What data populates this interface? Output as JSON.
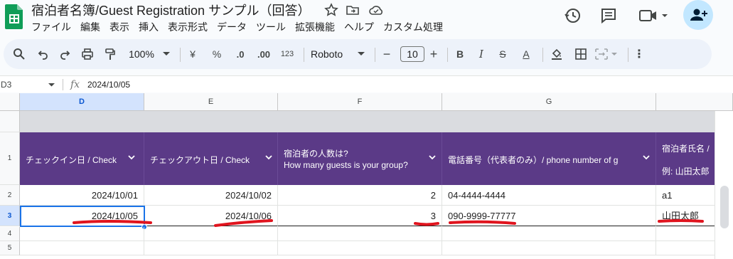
{
  "app": {
    "title": "宿泊者名簿/Guest Registration サンプル（回答）",
    "menu": [
      "ファイル",
      "編集",
      "表示",
      "挿入",
      "表示形式",
      "データ",
      "ツール",
      "拡張機能",
      "ヘルプ",
      "カスタム処理"
    ]
  },
  "toolbar": {
    "zoom": "100%",
    "currency": "¥",
    "percent": "%",
    "dec_decrease": ".0",
    "dec_increase": ".00",
    "format_more": "123",
    "font": "Roboto",
    "font_size": "10",
    "minus": "−",
    "plus": "+",
    "bold": "B",
    "italic": "I",
    "strike": "S",
    "text_color": "A",
    "more": "⋮"
  },
  "formula_bar": {
    "name_box": "D3",
    "fx": "fx",
    "value": "2024/10/05"
  },
  "grid": {
    "columns": [
      "D",
      "E",
      "F",
      "G"
    ],
    "rows": [
      "1",
      "2",
      "3",
      "4",
      "5"
    ],
    "headers": {
      "d": "チェックイン日 / Check",
      "e": "チェックアウト日 / Check",
      "f_line1": "宿泊者の人数は?",
      "f_line2": "How many guests is your group?",
      "g": "電話番号（代表者のみ）/ phone number of g",
      "h_line1": "宿泊者氏名 /",
      "h_line2": "例: 山田太郎"
    },
    "row2": {
      "d": "2024/10/01",
      "e": "2024/10/02",
      "f": "2",
      "g": "04-4444-4444",
      "h": "a1"
    },
    "row3": {
      "d": "2024/10/05",
      "e": "2024/10/06",
      "f": "3",
      "g": "090-9999-77777",
      "h": "山田太郎"
    }
  },
  "colors": {
    "header_purple": "#5b3a87",
    "selection_blue": "#1a73e8",
    "annotation_red": "#e0141e"
  }
}
